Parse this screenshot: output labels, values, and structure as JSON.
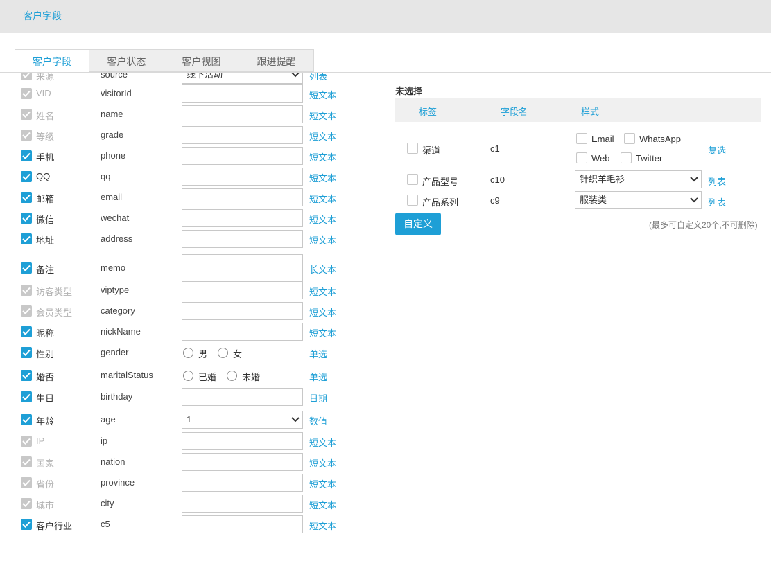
{
  "header": {
    "title": "客户字段"
  },
  "tabs": [
    {
      "label": "客户字段",
      "active": true
    },
    {
      "label": "客户状态",
      "active": false
    },
    {
      "label": "客户视图",
      "active": false
    },
    {
      "label": "跟进提醒",
      "active": false
    }
  ],
  "fields": [
    {
      "label": "来源",
      "field": "source",
      "checked": true,
      "disabled": true,
      "control": "select",
      "value": "线下活动",
      "type": "列表"
    },
    {
      "label": "VID",
      "field": "visitorId",
      "checked": true,
      "disabled": true,
      "control": "input",
      "type": "短文本"
    },
    {
      "label": "姓名",
      "field": "name",
      "checked": true,
      "disabled": true,
      "control": "input",
      "type": "短文本"
    },
    {
      "label": "等级",
      "field": "grade",
      "checked": true,
      "disabled": true,
      "control": "input",
      "type": "短文本"
    },
    {
      "label": "手机",
      "field": "phone",
      "checked": true,
      "disabled": false,
      "control": "input",
      "type": "短文本"
    },
    {
      "label": "QQ",
      "field": "qq",
      "checked": true,
      "disabled": false,
      "control": "input",
      "type": "短文本"
    },
    {
      "label": "邮箱",
      "field": "email",
      "checked": true,
      "disabled": false,
      "control": "input",
      "type": "短文本"
    },
    {
      "label": "微信",
      "field": "wechat",
      "checked": true,
      "disabled": false,
      "control": "input",
      "type": "短文本"
    },
    {
      "label": "地址",
      "field": "address",
      "checked": true,
      "disabled": false,
      "control": "input",
      "type": "短文本"
    },
    {
      "label": "备注",
      "field": "memo",
      "checked": true,
      "disabled": false,
      "control": "textarea",
      "type": "长文本"
    },
    {
      "label": "访客类型",
      "field": "viptype",
      "checked": true,
      "disabled": true,
      "control": "input",
      "type": "短文本"
    },
    {
      "label": "会员类型",
      "field": "category",
      "checked": true,
      "disabled": true,
      "control": "input",
      "type": "短文本"
    },
    {
      "label": "昵称",
      "field": "nickName",
      "checked": true,
      "disabled": false,
      "control": "input",
      "type": "短文本"
    },
    {
      "label": "性别",
      "field": "gender",
      "checked": true,
      "disabled": false,
      "control": "radio",
      "options": [
        "男",
        "女"
      ],
      "type": "单选"
    },
    {
      "label": "婚否",
      "field": "maritalStatus",
      "checked": true,
      "disabled": false,
      "control": "radio",
      "options": [
        "已婚",
        "未婚"
      ],
      "type": "单选"
    },
    {
      "label": "生日",
      "field": "birthday",
      "checked": true,
      "disabled": false,
      "control": "input",
      "type": "日期"
    },
    {
      "label": "年龄",
      "field": "age",
      "checked": true,
      "disabled": false,
      "control": "select",
      "value": "1",
      "type": "数值"
    },
    {
      "label": "IP",
      "field": "ip",
      "checked": true,
      "disabled": true,
      "control": "input",
      "type": "短文本"
    },
    {
      "label": "国家",
      "field": "nation",
      "checked": true,
      "disabled": true,
      "control": "input",
      "type": "短文本"
    },
    {
      "label": "省份",
      "field": "province",
      "checked": true,
      "disabled": true,
      "control": "input",
      "type": "短文本"
    },
    {
      "label": "城市",
      "field": "city",
      "checked": true,
      "disabled": true,
      "control": "input",
      "type": "短文本"
    },
    {
      "label": "客户行业",
      "field": "c5",
      "checked": true,
      "disabled": false,
      "control": "input",
      "type": "短文本"
    }
  ],
  "unselected": {
    "title": "未选择",
    "columns": [
      "标签",
      "字段名",
      "样式"
    ],
    "rows": [
      {
        "label": "渠道",
        "field": "c1",
        "options": [
          "Email",
          "WhatsApp",
          "Web",
          "Twitter"
        ],
        "type": "复选"
      },
      {
        "label": "产品型号",
        "field": "c10",
        "value": "针织羊毛衫",
        "type": "列表"
      },
      {
        "label": "产品系列",
        "field": "c9",
        "value": "服装类",
        "type": "列表"
      }
    ],
    "custom_button": "自定义",
    "note": "(最多可自定义20个,不可删除)"
  },
  "colors": {
    "accent": "#1e9fd6",
    "disabled": "#c8c8c8"
  }
}
